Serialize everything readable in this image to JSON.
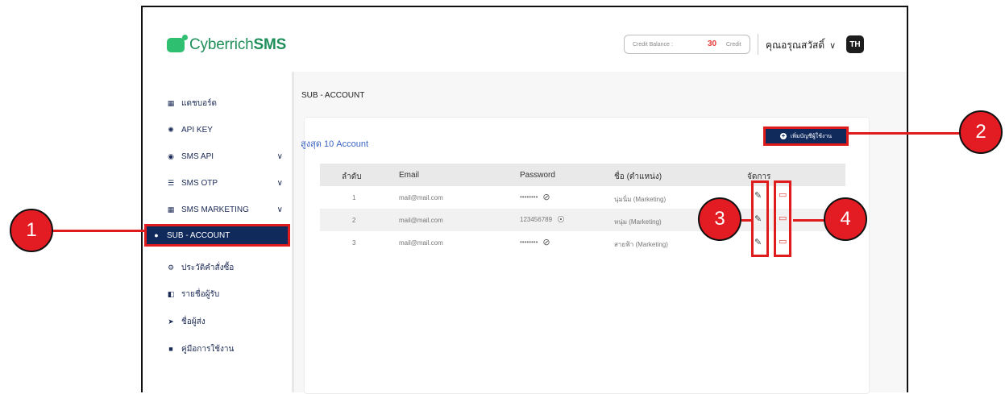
{
  "app": {
    "logo_prefix": "Cyberrich",
    "logo_bold": "SMS"
  },
  "header": {
    "credit_label": "Credit Balance :",
    "credit_value": "30",
    "credit_unit": "Credit",
    "user_name": "คุณอรุณสวัสดิ์",
    "avatar": "TH"
  },
  "sidebar": {
    "items": [
      {
        "label": "แดชบอร์ด",
        "icon": "dashboard-icon"
      },
      {
        "label": "API KEY",
        "icon": "key-icon"
      },
      {
        "label": "SMS API",
        "icon": "api-icon",
        "expandable": true
      },
      {
        "label": "SMS OTP",
        "icon": "otp-icon",
        "expandable": true
      },
      {
        "label": "SMS MARKETING",
        "icon": "marketing-icon",
        "expandable": true
      },
      {
        "label": "SUB - ACCOUNT",
        "icon": "user-icon",
        "active": true
      },
      {
        "label": "ประวัติคำสั่งซื้อ",
        "icon": "gear-icon"
      },
      {
        "label": "รายชื่อผู้รับ",
        "icon": "contacts-icon"
      },
      {
        "label": "ชื่อผู้ส่ง",
        "icon": "send-icon"
      },
      {
        "label": "คู่มือการใช้งาน",
        "icon": "book-icon"
      }
    ]
  },
  "main": {
    "title": "SUB - ACCOUNT",
    "card_heading": "สูงสุด 10 Account",
    "add_button": "เพิ่มบัญชีผู้ใช้งาน",
    "columns": [
      "ลำดับ",
      "Email",
      "Password",
      "ชื่อ (ตำแหน่ง)",
      "จัดการ"
    ],
    "rows": [
      {
        "no": "1",
        "email": "mail@mail.com",
        "password": "••••••••",
        "name": "นุ่มนิ่ม (Marketing)",
        "pw_visible": false
      },
      {
        "no": "2",
        "email": "mail@mail.com",
        "password": "123456789",
        "name": "หนุ่ม (Marketing)",
        "pw_visible": true
      },
      {
        "no": "3",
        "email": "mail@mail.com",
        "password": "••••••••",
        "name": "สายฟ้า (Marketing)",
        "pw_visible": false
      }
    ]
  },
  "callouts": [
    "1",
    "2",
    "3",
    "4"
  ],
  "colors": {
    "accent": "#102a5c",
    "brand": "#2fbf71",
    "highlight": "#e01b1b",
    "danger": "#e53935"
  }
}
